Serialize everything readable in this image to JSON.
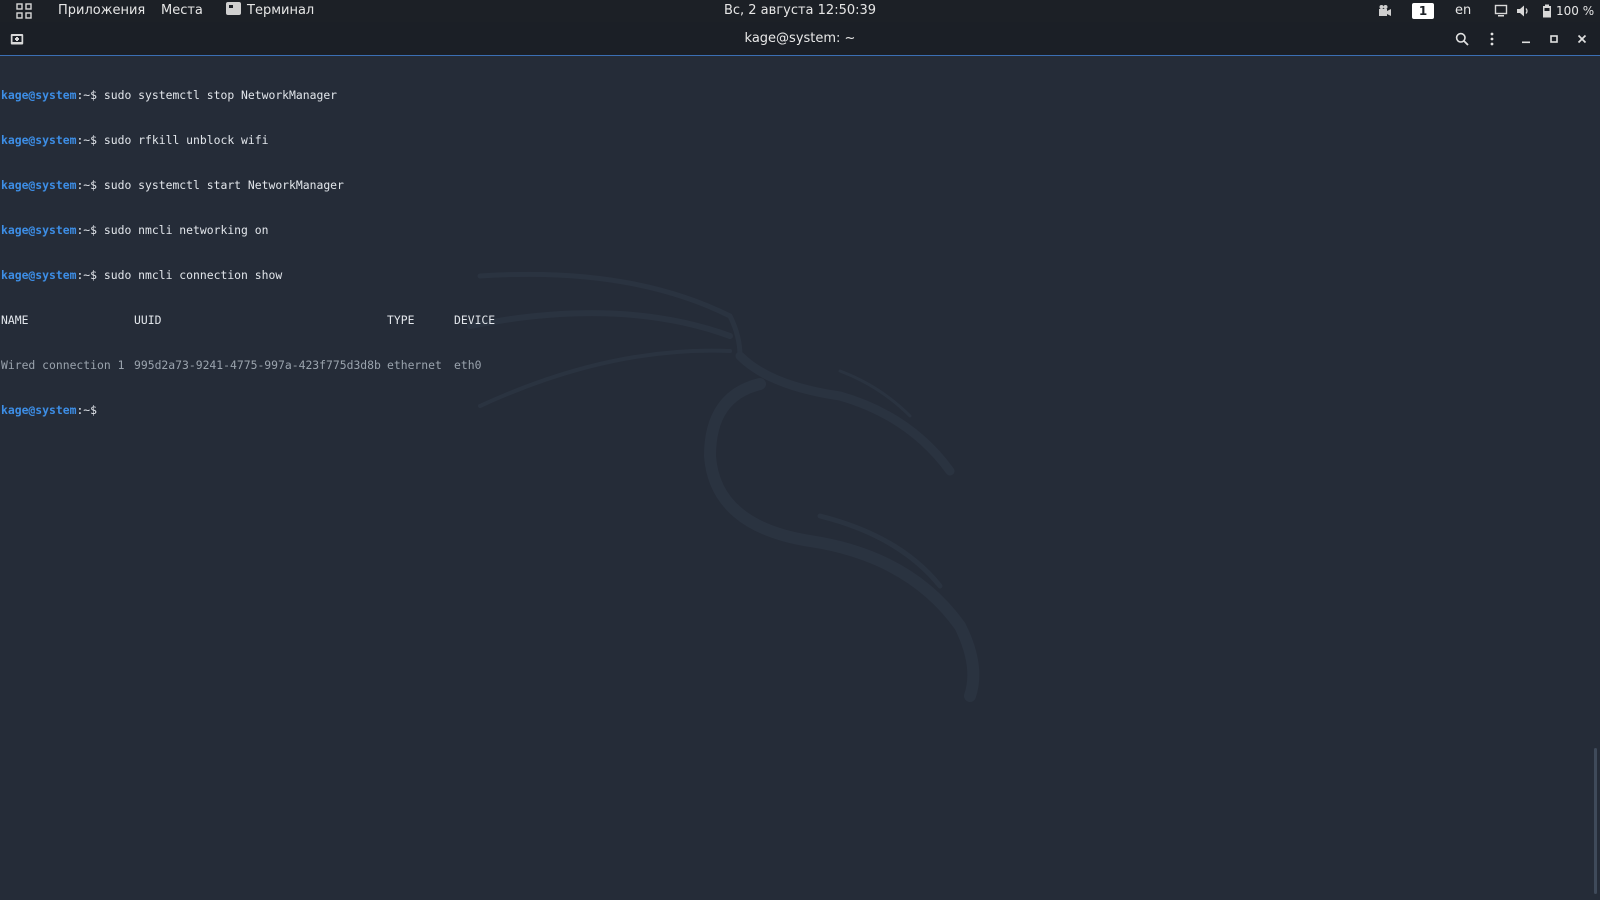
{
  "top_panel": {
    "apps_icon": "apps-grid-icon",
    "menu_applications": "Приложения",
    "menu_places": "Места",
    "menu_terminal": "Терминал",
    "clock": "Вс, 2 августа  12:50:39",
    "workspace": "1",
    "language": "en",
    "battery": "100 %"
  },
  "window": {
    "title": "kage@system: ~",
    "icons": {
      "new_tab": "new-tab-icon",
      "search": "search-icon",
      "menu": "kebab-menu-icon",
      "minimize": "minimize-icon",
      "maximize": "maximize-icon",
      "close": "close-icon"
    }
  },
  "terminal": {
    "prompt_user": "kage@system",
    "prompt_sep": ":~$",
    "commands": [
      "sudo systemctl stop NetworkManager",
      "sudo rfkill unblock wifi",
      "sudo systemctl start NetworkManager",
      "sudo nmcli networking on",
      "sudo nmcli connection show"
    ],
    "table": {
      "headers": [
        "NAME",
        "UUID",
        "TYPE",
        "DEVICE"
      ],
      "rows": [
        [
          "Wired connection 1",
          "995d2a73-9241-4775-997a-423f775d3d8b",
          "ethernet",
          "eth0"
        ]
      ]
    }
  },
  "colors": {
    "prompt": "#3d8ee6",
    "terminal_bg": "#252c38",
    "panel_bg": "#1c2026",
    "accent_border": "#3b6fb4"
  }
}
